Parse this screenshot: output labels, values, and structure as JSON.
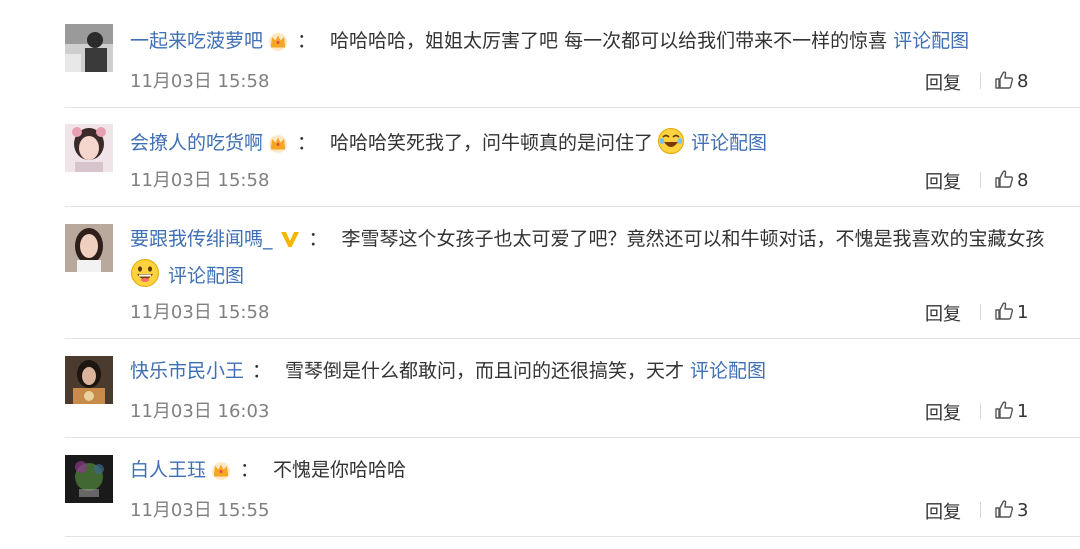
{
  "comments": [
    {
      "username": "一起来吃菠萝吧",
      "badge": "crown",
      "text": "哈哈哈哈，姐姐太厉害了吧 每一次都可以给我们带来不一样的惊喜",
      "link": "评论配图",
      "time": "11月03日 15:58",
      "reply": "回复",
      "likes": "8"
    },
    {
      "username": "会撩人的吃货啊",
      "badge": "crown",
      "text": "哈哈哈笑死我了，问牛顿真的是问住了",
      "emoji": "laughing-emoji",
      "link": "评论配图",
      "time": "11月03日 15:58",
      "reply": "回复",
      "likes": "8"
    },
    {
      "username": "要跟我传绯闻嗎_",
      "badge": "verified-v",
      "text": "李雪琴这个女孩子也太可爱了吧？竟然还可以和牛顿对话，不愧是我喜欢的宝藏女孩",
      "emoji": "grinning-emoji",
      "link": "评论配图",
      "time": "11月03日 15:58",
      "reply": "回复",
      "likes": "1"
    },
    {
      "username": "快乐市民小王",
      "badge": "",
      "text": "雪琴倒是什么都敢问，而且问的还很搞笑，天才",
      "link": "评论配图",
      "time": "11月03日 16:03",
      "reply": "回复",
      "likes": "1"
    },
    {
      "username": "白人王珏",
      "badge": "crown",
      "text": "不愧是你哈哈哈",
      "link": "",
      "time": "11月03日 15:55",
      "reply": "回复",
      "likes": "3"
    }
  ],
  "colon": "：",
  "colors": {
    "username": "#3f6fb4",
    "link": "#3f6fb4",
    "timestamp": "#808080",
    "crown": "#f5a623",
    "verified": "#f7b500",
    "divider": "#e3e3e3"
  },
  "icons": [
    "crown-badge-icon",
    "verified-v-icon",
    "thumbs-up-icon",
    "laughing-emoji",
    "grinning-emoji"
  ]
}
